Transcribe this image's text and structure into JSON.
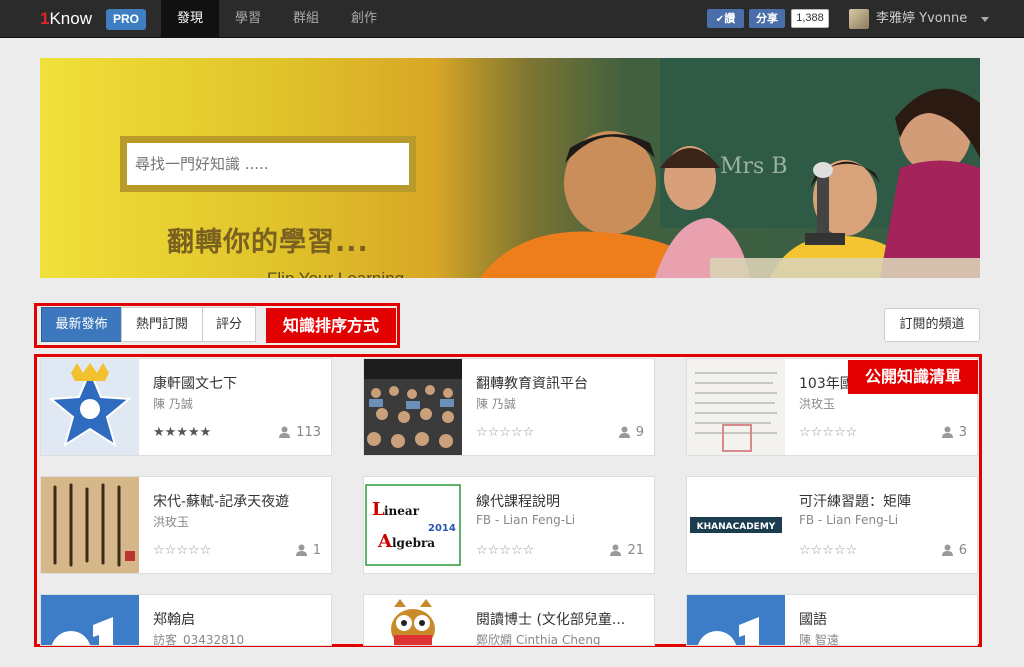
{
  "topbar": {
    "logo_one": "1",
    "logo_text": "Know",
    "pro_badge": "PRO",
    "nav": [
      "發現",
      "學習",
      "群組",
      "創作"
    ],
    "fb_like": "讚",
    "fb_share": "分享",
    "fb_count": "1,388",
    "username": "李雅婷 Yvonne"
  },
  "hero": {
    "search_placeholder": "尋找一門好知識 .....",
    "title": "翻轉你的學習...",
    "subtitle": "Flip Your Learning..."
  },
  "sort": {
    "buttons": [
      "最新發佈",
      "熱門訂閱",
      "評分"
    ],
    "active_index": 0,
    "annotation": "知識排序方式"
  },
  "subscribed_button": "訂閱的頻道",
  "list": {
    "annotation": "公開知識清單",
    "cards": [
      {
        "title": "康軒國文七下",
        "author": "陳 乃誠",
        "stars": "★★★★★",
        "rated": true,
        "subscribers": "113",
        "thumb": "star-badge"
      },
      {
        "title": "翻轉教育資訊平台",
        "author": "陳 乃誠",
        "stars": "☆☆☆☆☆",
        "rated": false,
        "subscribers": "9",
        "thumb": "classroom-photo"
      },
      {
        "title": "103年國",
        "author": "洪玫玉",
        "stars": "☆☆☆☆☆",
        "rated": false,
        "subscribers": "3",
        "thumb": "document-scan"
      },
      {
        "title": "宋代-蘇軾-記承天夜遊",
        "author": "洪玫玉",
        "stars": "☆☆☆☆☆",
        "rated": false,
        "subscribers": "1",
        "thumb": "calligraphy"
      },
      {
        "title": "線代課程說明",
        "author": "FB - Lian Feng-Li",
        "stars": "☆☆☆☆☆",
        "rated": false,
        "subscribers": "21",
        "thumb": "linear-algebra"
      },
      {
        "title": "可汗練習題：矩陣",
        "author": "FB - Lian Feng-Li",
        "stars": "☆☆☆☆☆",
        "rated": false,
        "subscribers": "6",
        "thumb": "khan-academy"
      },
      {
        "title": "郑翰启",
        "author": "訪客_03432810",
        "stars": "",
        "rated": false,
        "subscribers": "",
        "thumb": "default-1"
      },
      {
        "title": "閱讀博士 (文化部兒童...",
        "author": "鄭欣嫻 Cinthia Cheng",
        "stars": "",
        "rated": false,
        "subscribers": "",
        "thumb": "owl"
      },
      {
        "title": "國語",
        "author": "陳 智遠",
        "stars": "",
        "rated": false,
        "subscribers": "",
        "thumb": "default-1"
      }
    ]
  },
  "thumb_text": {
    "linear_word1": "inear",
    "linear_word2": "lgebra",
    "linear_year": "2014",
    "khan": "KHANACADEMY"
  },
  "colors": {
    "accent_red": "#e30000",
    "pro_blue": "#3f7ec0",
    "active_sort": "#3d78bf",
    "topbar": "#2b2b2b"
  }
}
